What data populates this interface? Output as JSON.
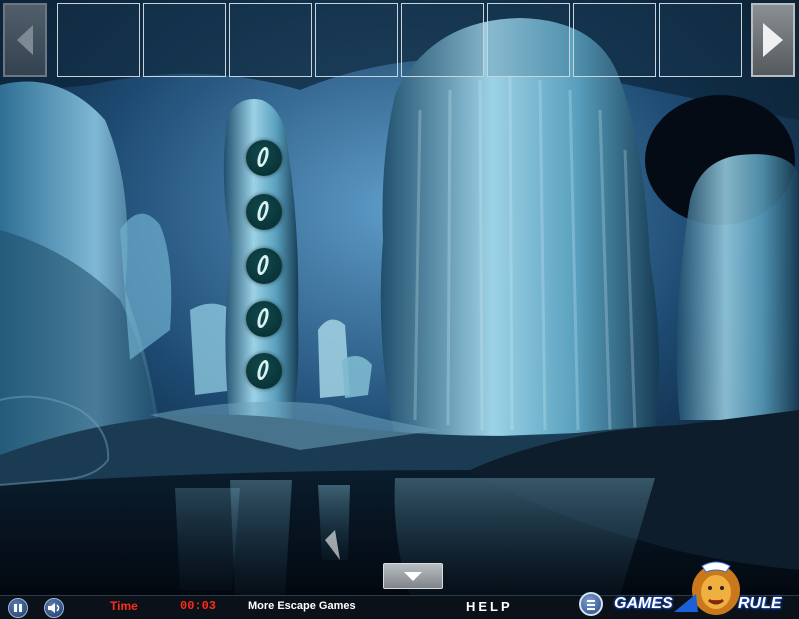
{
  "inventory": {
    "nav_left": "left-arrow",
    "nav_right": "right-arrow",
    "slot_count": 8
  },
  "scene": {
    "name": "blue stalactite cave",
    "puzzle_pillar": {
      "buttons": [
        {
          "symbol": "0"
        },
        {
          "symbol": "0"
        },
        {
          "symbol": "0"
        },
        {
          "symbol": "0"
        },
        {
          "symbol": "0"
        }
      ]
    },
    "nav_down": "down-arrow"
  },
  "status_bar": {
    "time_label": "Time",
    "timer": "00:03",
    "more_games": "More Escape Games",
    "help": "HELP",
    "pause_icon": "pause-icon",
    "sound_icon": "speaker-icon",
    "menu_icon": "menu-icon"
  },
  "logo": {
    "left_word": "GAMES",
    "right_word": "RULE"
  },
  "colors": {
    "cave_blue": "#3f86b8",
    "timer_red": "#ff2a1a",
    "bar_bg": "#0b1118"
  }
}
